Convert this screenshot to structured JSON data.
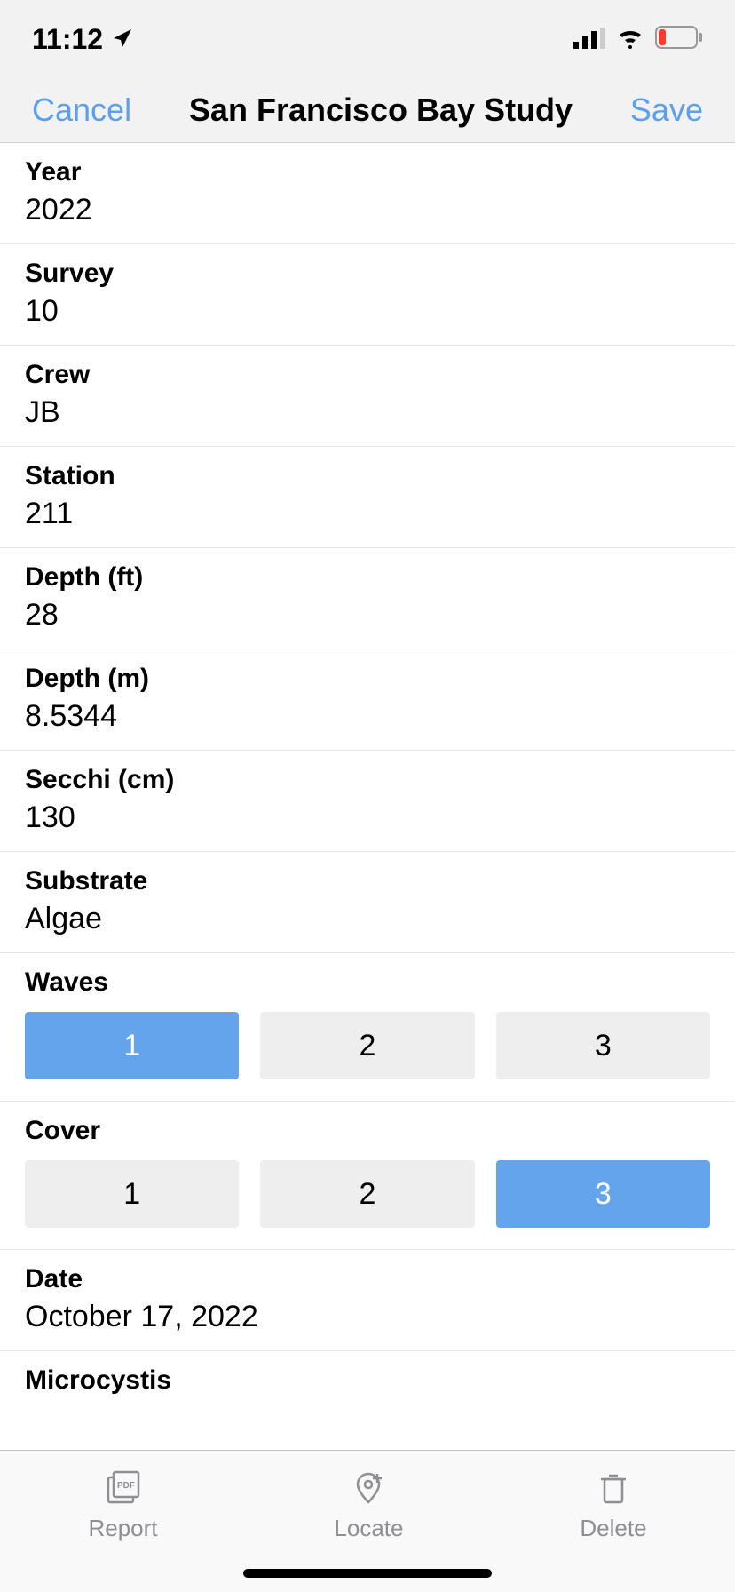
{
  "status": {
    "time": "11:12"
  },
  "nav": {
    "cancel": "Cancel",
    "title": "San Francisco Bay Study",
    "save": "Save"
  },
  "fields": {
    "year": {
      "label": "Year",
      "value": "2022"
    },
    "survey": {
      "label": "Survey",
      "value": "10"
    },
    "crew": {
      "label": "Crew",
      "value": "JB"
    },
    "station": {
      "label": "Station",
      "value": "211"
    },
    "depth_ft": {
      "label": "Depth (ft)",
      "value": "28"
    },
    "depth_m": {
      "label": "Depth (m)",
      "value": "8.5344"
    },
    "secchi": {
      "label": "Secchi (cm)",
      "value": "130"
    },
    "substrate": {
      "label": "Substrate",
      "value": "Algae"
    },
    "date": {
      "label": "Date",
      "value": "October 17, 2022"
    },
    "microcystis": {
      "label": "Microcystis"
    }
  },
  "waves": {
    "label": "Waves",
    "options": [
      "1",
      "2",
      "3"
    ],
    "selected": 0
  },
  "cover": {
    "label": "Cover",
    "options": [
      "1",
      "2",
      "3"
    ],
    "selected": 2
  },
  "bottom": {
    "report": "Report",
    "locate": "Locate",
    "delete": "Delete"
  }
}
